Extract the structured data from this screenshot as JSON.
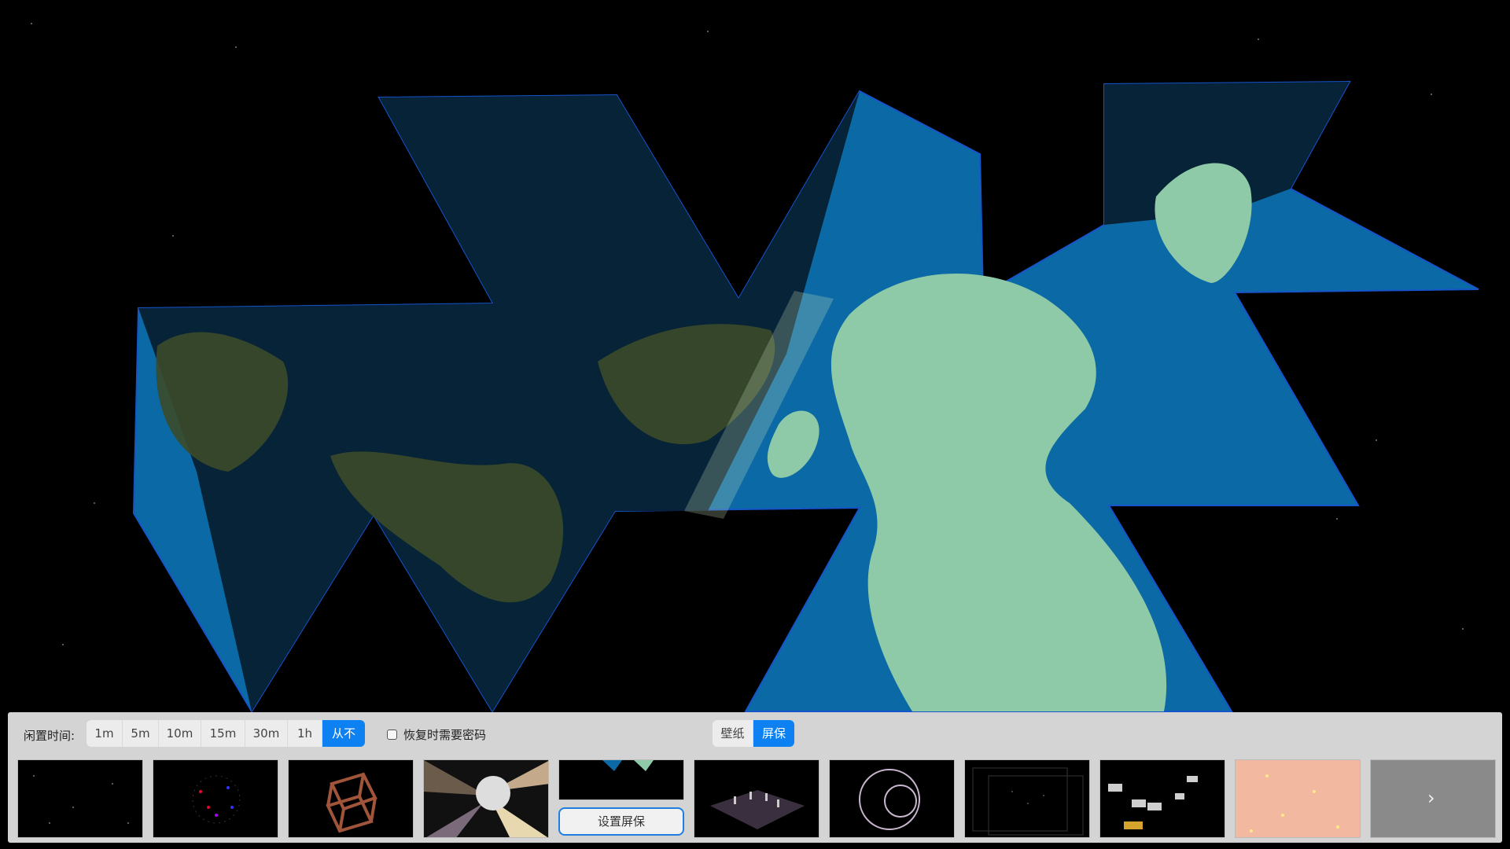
{
  "wallpaper": {
    "name": "dymaxion-world-map",
    "ocean": "#0b6aa6",
    "land": "#8fcaa8"
  },
  "toolbar": {
    "idle_label": "闲置时间:",
    "idle_options": [
      "1m",
      "5m",
      "10m",
      "15m",
      "30m",
      "1h",
      "从不"
    ],
    "idle_selected": "从不",
    "require_password_label": "恢复时需要密码",
    "require_password_checked": false,
    "mode_tabs": [
      "壁纸",
      "屏保"
    ],
    "mode_selected": "屏保"
  },
  "screensavers": {
    "set_button_label": "设置屏保",
    "next_label": "›",
    "items": [
      "starfield-preview",
      "particle-sphere-preview",
      "wire-cube-preview",
      "disco-ball-preview",
      "selected-preview",
      "grid-figures-preview",
      "circles-preview",
      "wire-box-preview",
      "spaceships-preview",
      "peach-dots-preview",
      "gray-next-preview"
    ]
  },
  "colors": {
    "accent": "#0d80f2",
    "panel": "#d4d4d4"
  }
}
